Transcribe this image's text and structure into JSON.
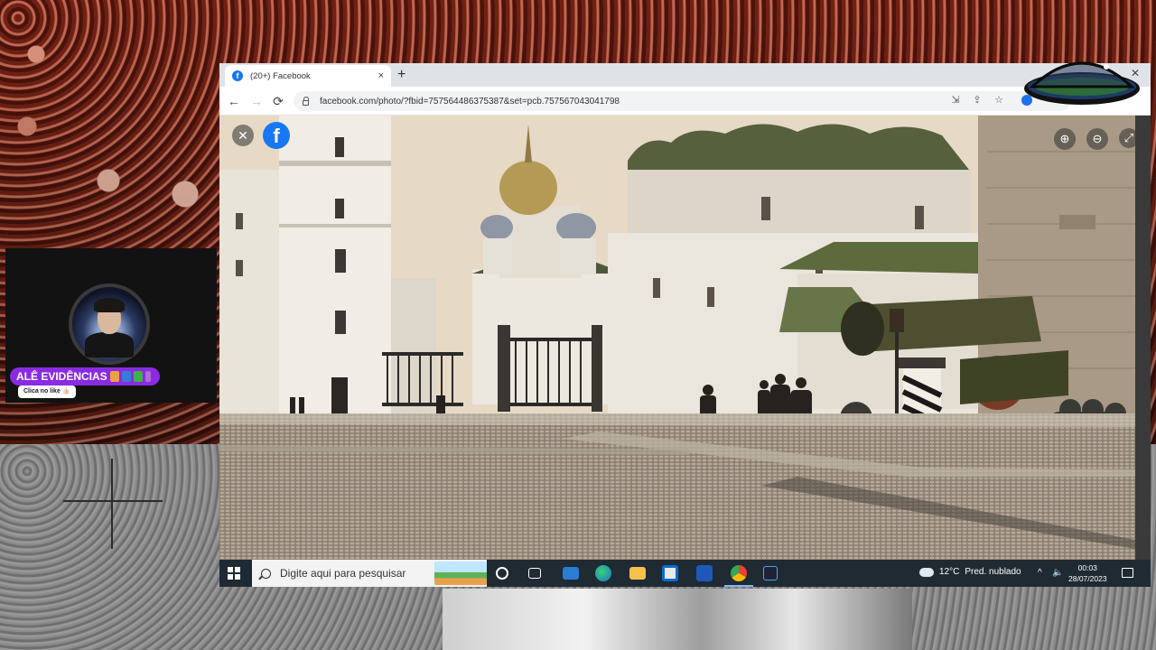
{
  "browser": {
    "tab_title": "(20+) Facebook",
    "favicon_letter": "f",
    "url": "facebook.com/photo/?fbid=757564486375387&set=pcb.757567043041798",
    "new_tab": "+",
    "tab_close": "×",
    "window_close": "✕"
  },
  "toolbar": {
    "back": "←",
    "forward": "→",
    "reload": "⟳"
  },
  "photo_viewer": {
    "close": "✕",
    "fb_logo": "f",
    "zoom_in": "⊕",
    "zoom_out": "⊖",
    "fullscreen": "⤢"
  },
  "taskbar": {
    "search_placeholder": "Digite aqui para pesquisar",
    "weather_temp": "12°C",
    "weather_desc": "Pred. nublado",
    "time": "00:03",
    "date": "28/07/2023"
  },
  "channel": {
    "name": "ALÊ EVIDÊNCIAS",
    "like_prompt": "Clica no like 👍🏻"
  },
  "colors": {
    "facebook_blue": "#1877f2",
    "channel_badge": "#8a2be2",
    "taskbar": "#1f2a33"
  }
}
